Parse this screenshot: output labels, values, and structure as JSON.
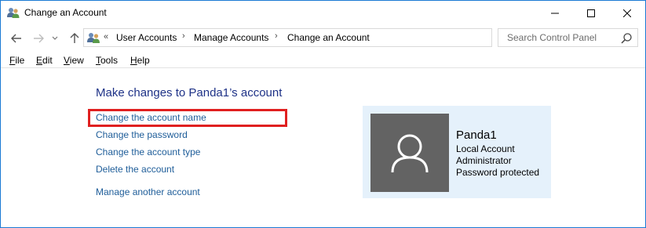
{
  "window": {
    "title": "Change an Account",
    "controls": {
      "minimize": "minimize",
      "maximize": "maximize",
      "close": "close"
    }
  },
  "address_bar": {
    "overflow": "«",
    "breadcrumbs": [
      "User Accounts",
      "Manage Accounts",
      "Change an Account"
    ]
  },
  "search": {
    "placeholder": "Search Control Panel"
  },
  "menu": [
    {
      "label": "File",
      "mnemonic": "F",
      "rest": "ile"
    },
    {
      "label": "Edit",
      "mnemonic": "E",
      "rest": "dit"
    },
    {
      "label": "View",
      "mnemonic": "V",
      "rest": "iew"
    },
    {
      "label": "Tools",
      "mnemonic": "T",
      "rest": "ools"
    },
    {
      "label": "Help",
      "mnemonic": "H",
      "rest": "elp"
    }
  ],
  "main": {
    "heading": "Make changes to Panda1’s account",
    "links": [
      "Change the account name",
      "Change the password",
      "Change the account type",
      "Delete the account",
      "Manage another account"
    ]
  },
  "account": {
    "name": "Panda1",
    "details": [
      "Local Account",
      "Administrator",
      "Password protected"
    ]
  },
  "colors": {
    "heading": "#1e3287",
    "link": "#1e5d99",
    "highlight_box": "#e02020",
    "card_background": "#e5f1fb",
    "avatar_background": "#636363"
  }
}
